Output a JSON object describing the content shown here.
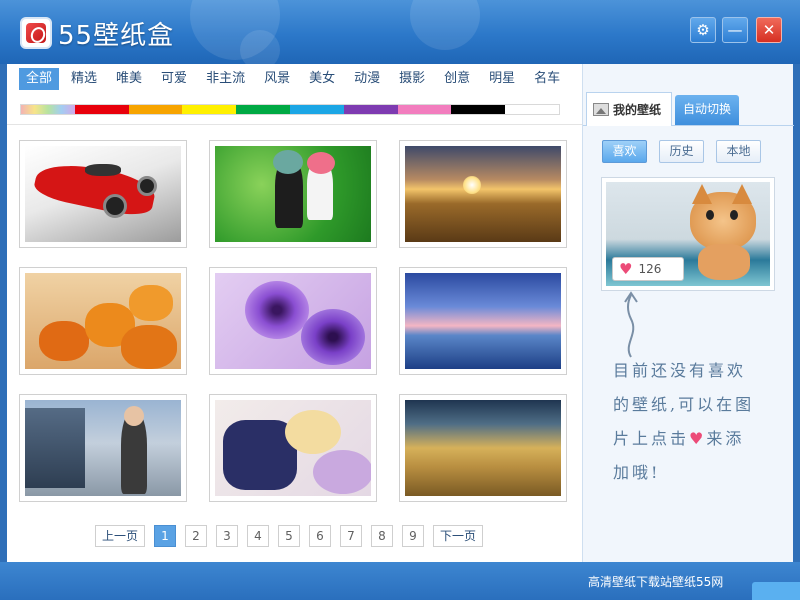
{
  "app": {
    "title": "55壁纸盒"
  },
  "window_buttons": {
    "settings": "⚙",
    "minimize": "—",
    "close": "✕"
  },
  "categories": [
    {
      "label": "全部",
      "active": true
    },
    {
      "label": "精选"
    },
    {
      "label": "唯美"
    },
    {
      "label": "可爱"
    },
    {
      "label": "非主流"
    },
    {
      "label": "风景"
    },
    {
      "label": "美女"
    },
    {
      "label": "动漫"
    },
    {
      "label": "摄影"
    },
    {
      "label": "创意"
    },
    {
      "label": "明星"
    },
    {
      "label": "名车"
    }
  ],
  "color_filters": [
    "rainbow",
    "#e8000b",
    "#f7a400",
    "#fff000",
    "#00a944",
    "#1ba6e5",
    "#7e3bb1",
    "#f27dbe",
    "#000000",
    "#ffffff"
  ],
  "wallpapers": [
    {
      "name": "red-sports-car"
    },
    {
      "name": "anime-girls-green"
    },
    {
      "name": "sunset-field"
    },
    {
      "name": "halloween-pumpkins"
    },
    {
      "name": "purple-flowers"
    },
    {
      "name": "sunrise-sea"
    },
    {
      "name": "girl-in-street"
    },
    {
      "name": "anime-couple"
    },
    {
      "name": "desert-sunset"
    }
  ],
  "pagination": {
    "prev": "上一页",
    "next": "下一页",
    "pages": [
      "1",
      "2",
      "3",
      "4",
      "5",
      "6",
      "7",
      "8",
      "9"
    ],
    "current": "1"
  },
  "right_panel": {
    "tabs": {
      "mine": "我的壁纸",
      "auto": "自动切换"
    },
    "buttons": {
      "like": "喜欢",
      "history": "历史",
      "local": "本地"
    },
    "like_count": "126",
    "hint_lines": [
      "目前还没有喜欢",
      "的壁纸,可以在图",
      "片上点击",
      "来添",
      "加哦!"
    ]
  },
  "status_bar": {
    "text": "高清壁纸下载站壁纸55网"
  }
}
